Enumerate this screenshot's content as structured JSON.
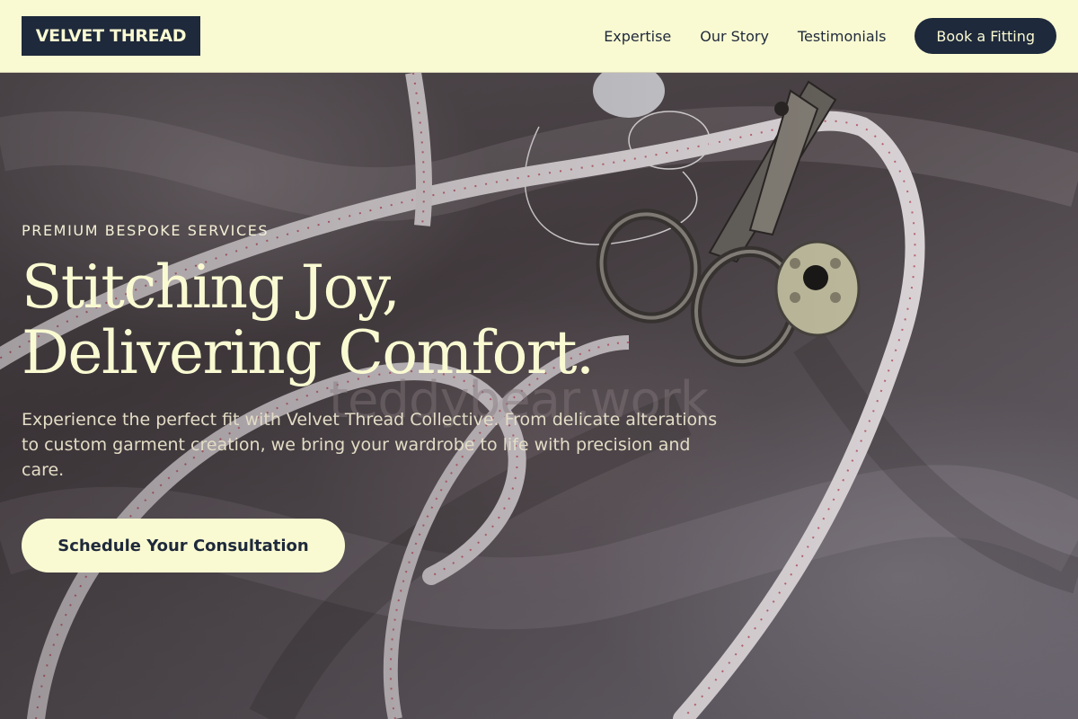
{
  "header": {
    "logo": "VELVET THREAD",
    "nav": [
      "Expertise",
      "Our Story",
      "Testimonials"
    ],
    "cta": "Book a Fitting"
  },
  "hero": {
    "eyebrow": "PREMIUM BESPOKE SERVICES",
    "headline_line1": "Stitching Joy,",
    "headline_line2": "Delivering Comfort.",
    "subtext": "Experience the perfect fit with Velvet Thread Collective. From delicate alterations to custom garment creation, we bring your wardrobe to life with precision and care.",
    "cta": "Schedule Your Consultation",
    "watermark": "teddybear.work"
  },
  "colors": {
    "cream": "#fafad2",
    "navy": "#1e293b"
  },
  "icons": [
    "scissors-icon",
    "bobbin-icon",
    "measuring-tape-icon"
  ]
}
